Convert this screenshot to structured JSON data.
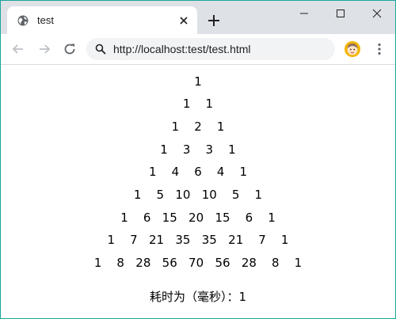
{
  "browser": {
    "tab_title": "test",
    "url": "http://localhost:test/test.html"
  },
  "page": {
    "rows": [
      "1",
      "1    1",
      "1    2    1",
      "1    3    3    1",
      "1    4    6    4    1",
      "1    5   10   10    5    1",
      "1    6   15   20   15    6    1",
      "1    7   21   35   35   21    7    1",
      "1    8   28   56   70   56   28    8    1"
    ],
    "timing_text": "耗时为（毫秒）：1"
  }
}
